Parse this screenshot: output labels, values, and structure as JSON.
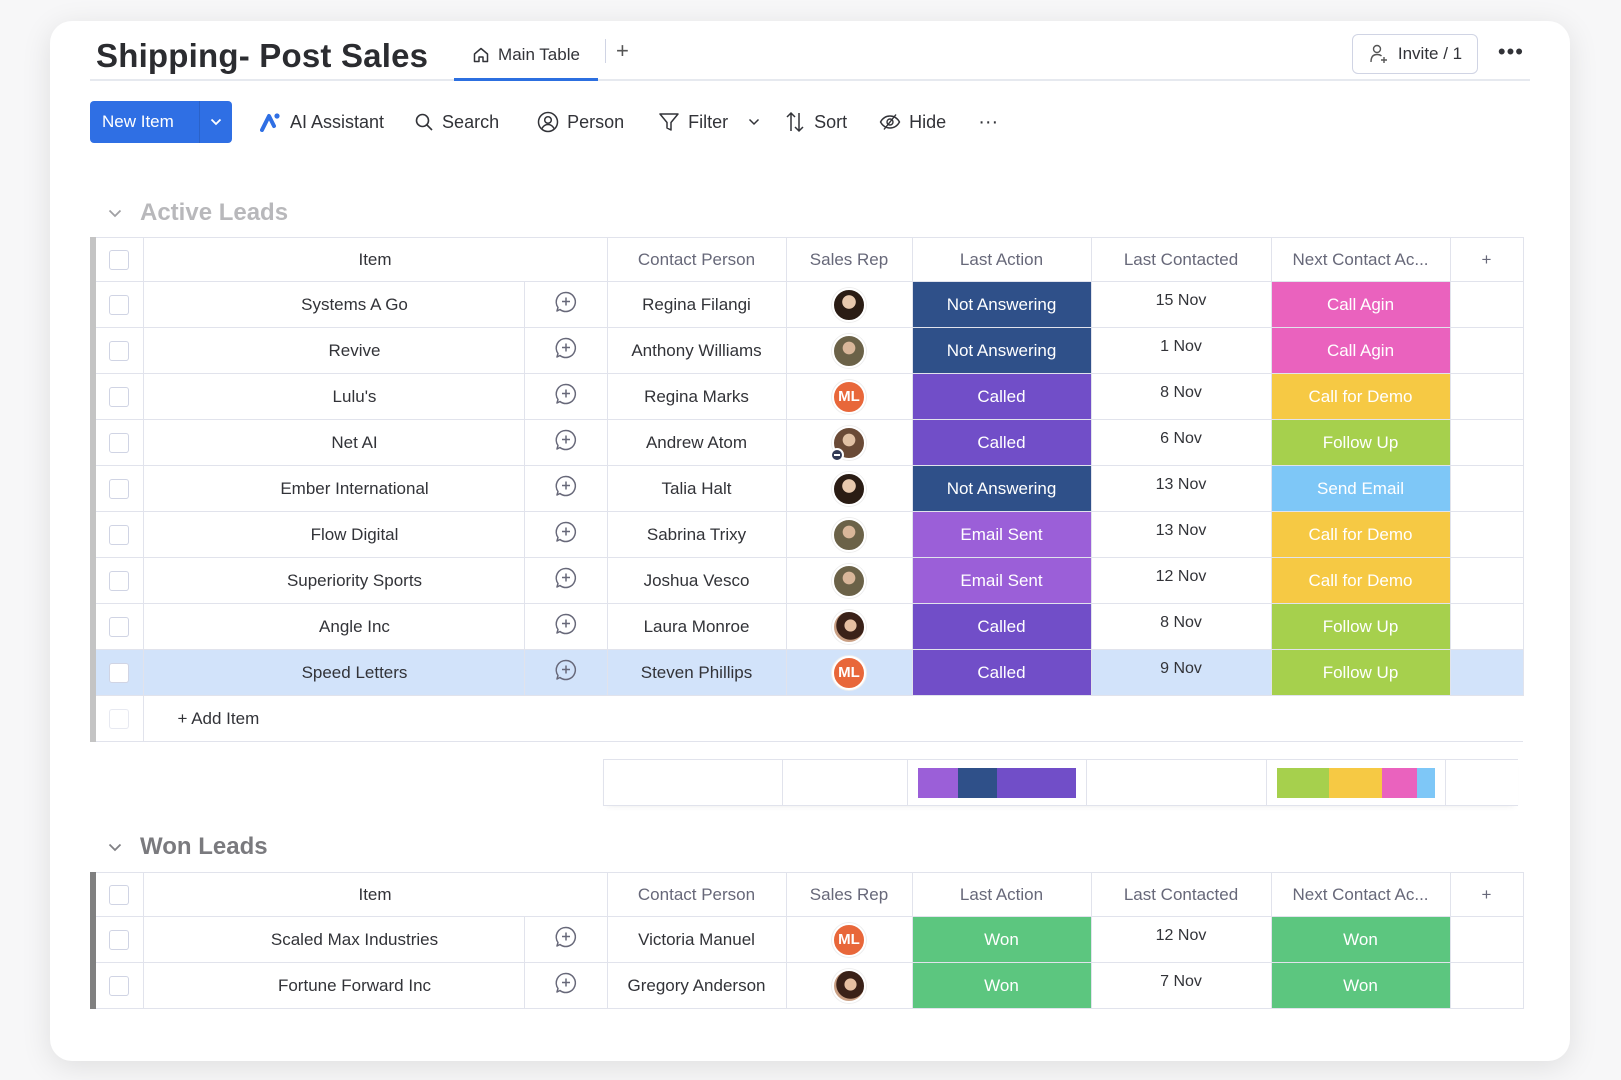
{
  "header": {
    "title": "Shipping- Post Sales",
    "tab_main": "Main Table",
    "tab_add": "+",
    "invite_label": "Invite / 1",
    "more": "•••"
  },
  "toolbar": {
    "new_item": "New Item",
    "ai_assistant": "AI Assistant",
    "search": "Search",
    "person": "Person",
    "filter": "Filter",
    "sort": "Sort",
    "hide": "Hide",
    "more": "···"
  },
  "colors": {
    "not_answering": "#2f5089",
    "called": "#714ec8",
    "email_sent": "#9b5fd8",
    "call_agin": "#ea62be",
    "call_for_demo": "#f6c944",
    "follow_up": "#a6d04d",
    "send_email": "#7ec7f7",
    "won": "#5cc67f",
    "accent": "#2f6fe4"
  },
  "columns": {
    "item": "Item",
    "contact": "Contact Person",
    "rep": "Sales Rep",
    "last_action": "Last Action",
    "last_contacted": "Last Contacted",
    "next": "Next Contact Ac...",
    "add": "+"
  },
  "groups": [
    {
      "title": "Active Leads",
      "add_item": "+ Add Item",
      "rows": [
        {
          "item": "Systems A Go",
          "contact": "Regina Filangi",
          "rep": {
            "type": "photo",
            "tone": "dark"
          },
          "last_action": "Not Answering",
          "last_contacted": "15 Nov",
          "next": "Call Agin",
          "selected": false
        },
        {
          "item": "Revive",
          "contact": "Anthony Williams",
          "rep": {
            "type": "photo",
            "tone": "olive"
          },
          "last_action": "Not Answering",
          "last_contacted": "1 Nov",
          "next": "Call Agin",
          "selected": false
        },
        {
          "item": "Lulu's",
          "contact": "Regina Marks",
          "rep": {
            "type": "initials",
            "initials": "ML"
          },
          "last_action": "Called",
          "last_contacted": "8 Nov",
          "next": "Call for Demo",
          "selected": false
        },
        {
          "item": "Net AI",
          "contact": "Andrew Atom",
          "rep": {
            "type": "photo",
            "tone": "brown",
            "away": true
          },
          "last_action": "Called",
          "last_contacted": "6 Nov",
          "next": "Follow Up",
          "selected": false
        },
        {
          "item": "Ember International",
          "contact": "Talia Halt",
          "rep": {
            "type": "photo",
            "tone": "dark"
          },
          "last_action": "Not Answering",
          "last_contacted": "13 Nov",
          "next": "Send Email",
          "selected": false
        },
        {
          "item": "Flow Digital",
          "contact": "Sabrina Trixy",
          "rep": {
            "type": "photo",
            "tone": "olive"
          },
          "last_action": "Email Sent",
          "last_contacted": "13 Nov",
          "next": "Call for Demo",
          "selected": false
        },
        {
          "item": "Superiority Sports",
          "contact": "Joshua Vesco",
          "rep": {
            "type": "photo",
            "tone": "olive"
          },
          "last_action": "Email Sent",
          "last_contacted": "12 Nov",
          "next": "Call for Demo",
          "selected": false
        },
        {
          "item": "Angle Inc",
          "contact": "Laura Monroe",
          "rep": {
            "type": "photo",
            "tone": "warm"
          },
          "last_action": "Called",
          "last_contacted": "8 Nov",
          "next": "Follow Up",
          "selected": false
        },
        {
          "item": "Speed Letters",
          "contact": "Steven Phillips",
          "rep": {
            "type": "initials",
            "initials": "ML"
          },
          "last_action": "Called",
          "last_contacted": "9 Nov",
          "next": "Follow Up",
          "selected": true
        }
      ],
      "summary": {
        "last_action": [
          {
            "label": "Email Sent",
            "count": 2
          },
          {
            "label": "Not Answering",
            "count": 2
          },
          {
            "label": "Called",
            "count": 4
          }
        ],
        "next": [
          {
            "label": "Follow Up",
            "count": 3
          },
          {
            "label": "Call for Demo",
            "count": 3
          },
          {
            "label": "Call Agin",
            "count": 2
          },
          {
            "label": "Send Email",
            "count": 1
          }
        ]
      }
    },
    {
      "title": "Won Leads",
      "rows": [
        {
          "item": "Scaled Max Industries",
          "contact": "Victoria Manuel",
          "rep": {
            "type": "initials",
            "initials": "ML"
          },
          "last_action": "Won",
          "last_contacted": "12 Nov",
          "next": "Won",
          "selected": false
        },
        {
          "item": "Fortune Forward Inc",
          "contact": "Gregory Anderson",
          "rep": {
            "type": "photo",
            "tone": "warm"
          },
          "last_action": "Won",
          "last_contacted": "7 Nov",
          "next": "Won",
          "selected": false
        }
      ]
    }
  ]
}
